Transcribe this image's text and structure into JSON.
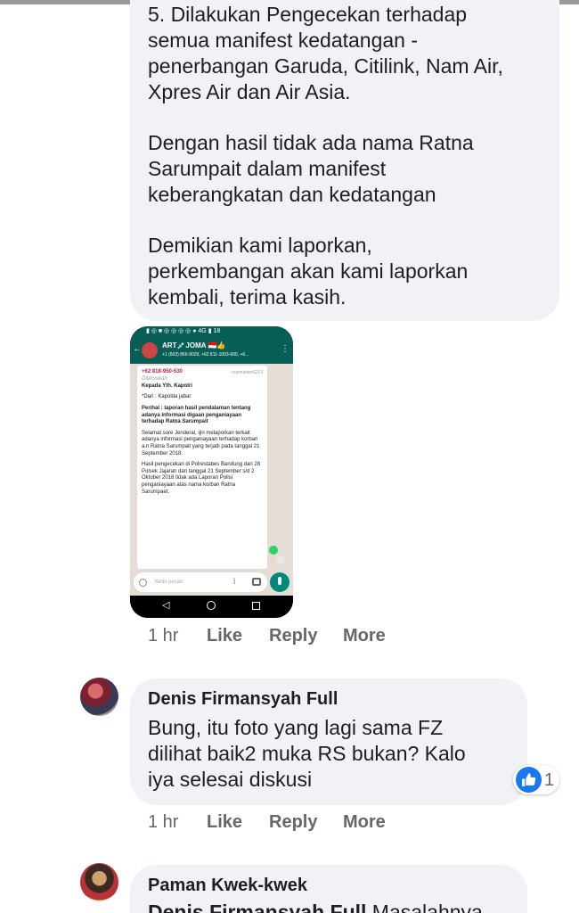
{
  "comment_1": {
    "paragraphs": [
      "5. Dilakukan Pengecekan terhadap\nsemua manifest kedatangan -\npenerbangan Garuda, Citilink, Nam Air,\nXpres Air dan Air Asia.",
      "Dengan hasil tidak ada nama Ratna\nSarumpait dalam manifest\nkeberangkatan dan kedatangan",
      "Demikian kami laporkan,\nperkembangan akan kami laporkan\nkembali, terima kasih."
    ],
    "attachment": {
      "status_bar": "▮ ◎ ■ ◎ ◎ ◎ ◎ ● 4G ▮ 18",
      "chat_title": "ART💉JOMA 🇮🇩👍",
      "chat_subtitle": "+1 (603) 866-9029, +62 811-1003-600, +6...",
      "sender_phone": "+62 818-950-530",
      "sender_tag": "~roymarten5213",
      "forwarded": "Diteruskan",
      "message_lines": [
        "Kepada Yth. Kapolri",
        "*Dari : Kapolda jabar",
        "Perihal : laporan hasil pendalaman tentang adanya informasi digaan penganiayaan terhadap Ratna Sarumpait",
        "Selamat sore Jenderal, ijin melaporkan terkait adanya informasi penganiayaan terhadap korban a.n Ratna Sarumpait yang terjadi pada tanggal 21 September 2018.",
        "Hasil pengecekan di Polrestabes Bandung dan 28 Polsek Jajaran dari tanggal 21 September s/d 2 Oktober 2018 tidak ada Laporan Polisi penganiayaan atas nama korban Ratna Sarumpaet."
      ],
      "input_placeholder": "Ketik pesan"
    },
    "actions": {
      "time": "1 hr",
      "like": "Like",
      "reply": "Reply",
      "more": "More"
    }
  },
  "comment_2": {
    "author": "Denis Firmansyah Full",
    "text": "Bung, itu foto yang lagi sama FZ\ndilihat baik2 muka RS bukan? Kalo\niya selesai diskusi",
    "reaction_count": "1",
    "actions": {
      "time": "1 hr",
      "like": "Like",
      "reply": "Reply",
      "more": "More"
    }
  },
  "comment_3": {
    "author": "Paman Kwek-kwek",
    "mention": "Denis Firmansyah Full",
    "text": " Masalahnya"
  },
  "colors": {
    "bubble": "#f0f2f5",
    "meta_text": "#65676b",
    "like_blue": "#1877f2",
    "whatsapp_green": "#075e54"
  }
}
